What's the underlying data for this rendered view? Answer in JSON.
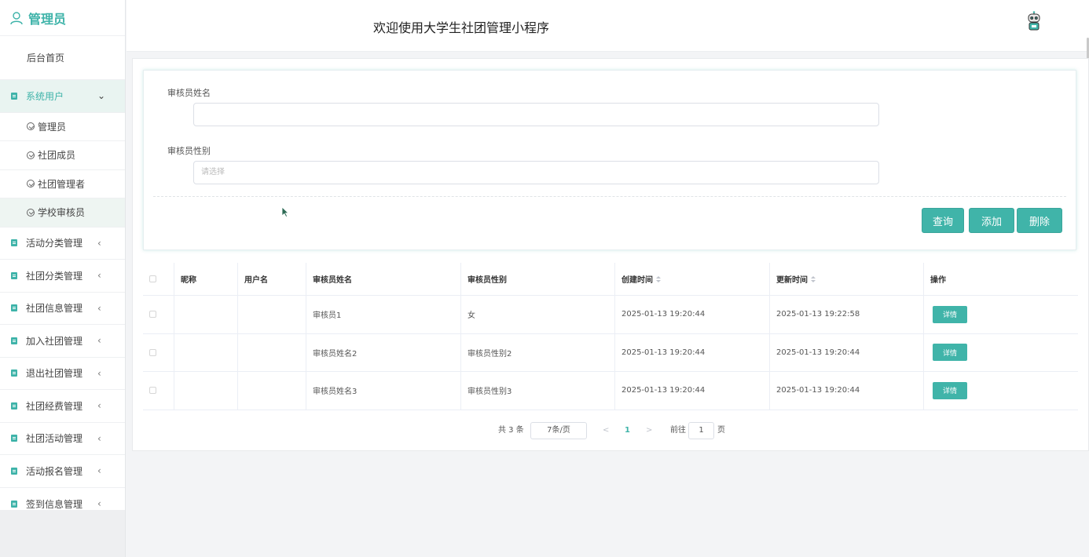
{
  "sidebar": {
    "brand": "管理员",
    "home": "后台首页",
    "active_group": "系统用户",
    "sub_items": [
      "管理员",
      "社团成员",
      "社团管理者",
      "学校审核员"
    ],
    "groups": [
      "活动分类管理",
      "社团分类管理",
      "社团信息管理",
      "加入社团管理",
      "退出社团管理",
      "社团经费管理",
      "社团活动管理",
      "活动报名管理",
      "签到信息管理"
    ]
  },
  "header": {
    "title": "欢迎使用大学生社团管理小程序"
  },
  "search": {
    "name_label": "审核员姓名",
    "name_value": "",
    "gender_label": "审核员性别",
    "gender_placeholder": "请选择",
    "query_button": "查询",
    "add_button": "添加",
    "delete_button": "删除"
  },
  "table": {
    "columns": [
      "昵称",
      "用户名",
      "审核员姓名",
      "审核员性别",
      "创建时间",
      "更新时间",
      "操作"
    ],
    "rows": [
      {
        "nickname": "",
        "username": "",
        "name": "审核员1",
        "gender": "女",
        "created": "2025-01-13 19:20:44",
        "updated": "2025-01-13 19:22:58",
        "action": "详情"
      },
      {
        "nickname": "",
        "username": "",
        "name": "审核员姓名2",
        "gender": "审核员性别2",
        "created": "2025-01-13 19:20:44",
        "updated": "2025-01-13 19:20:44",
        "action": "详情"
      },
      {
        "nickname": "",
        "username": "",
        "name": "审核员姓名3",
        "gender": "审核员性别3",
        "created": "2025-01-13 19:20:44",
        "updated": "2025-01-13 19:20:44",
        "action": "详情"
      }
    ]
  },
  "pagination": {
    "total": "共 3 条",
    "page_size": "7条/页",
    "prev": "<",
    "current": "1",
    "next": ">",
    "goto_prefix": "前往",
    "goto_value": "1",
    "goto_suffix": "页"
  },
  "colors": {
    "accent": "#40b4a9"
  },
  "icons": {
    "brand": "user-icon",
    "menu": "document-icon",
    "sub": "check-circle-icon",
    "avatar": "robot-avatar-icon"
  }
}
